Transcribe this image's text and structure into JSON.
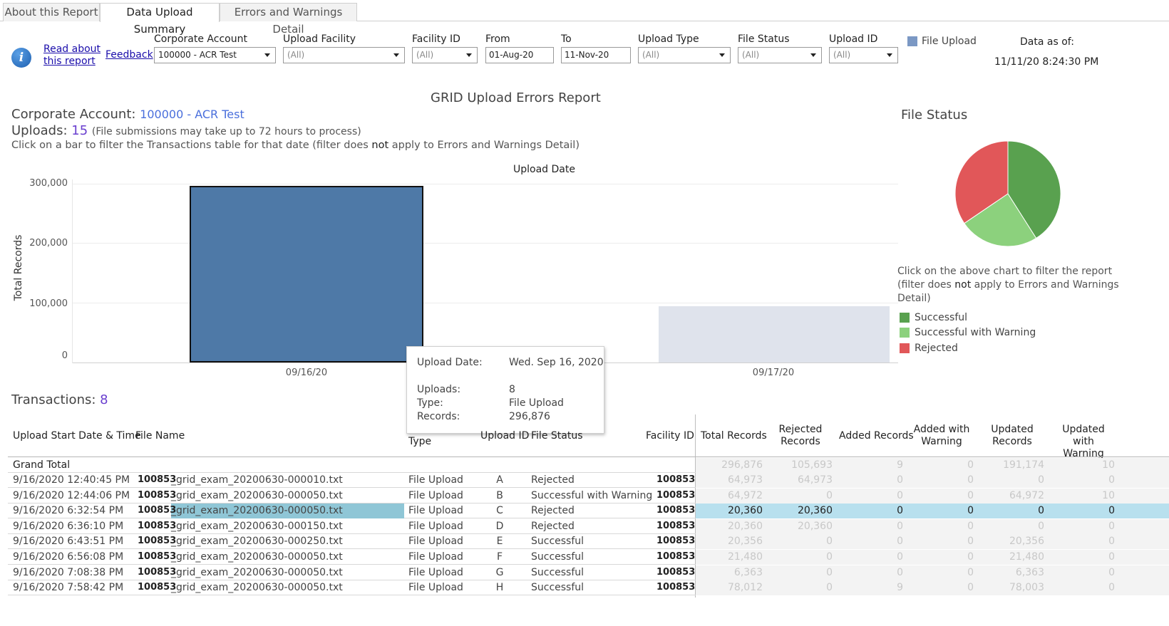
{
  "tabs": [
    "About this Report",
    "Data Upload Summary",
    "Errors and Warnings Detail"
  ],
  "header": {
    "read_about": "Read about this report",
    "read_about_line1": "Read about",
    "read_about_line2": "this report",
    "feedback": "Feedback",
    "data_as_of_label": "Data as of:",
    "data_as_of_value": "11/11/20 8:24:30 PM",
    "legend_label": "File Upload"
  },
  "filters": {
    "corporate_account": {
      "label": "Corporate Account",
      "value": "100000 - ACR Test"
    },
    "upload_facility": {
      "label": "Upload Facility",
      "value": "(All)"
    },
    "facility_id": {
      "label": "Facility ID",
      "value": "(All)"
    },
    "from": {
      "label": "From",
      "value": "01-Aug-20"
    },
    "to": {
      "label": "To",
      "value": "11-Nov-20"
    },
    "upload_type": {
      "label": "Upload Type",
      "value": "(All)"
    },
    "file_status": {
      "label": "File Status",
      "value": "(All)"
    },
    "upload_id": {
      "label": "Upload ID",
      "value": "(All)"
    }
  },
  "report": {
    "title": "GRID Upload Errors Report",
    "corp_label": "Corporate Account:",
    "corp_value": "100000 - ACR Test",
    "uploads_label": "Uploads:",
    "uploads_value": "15",
    "uploads_note": "(File submissions may take up to 72 hours to process)",
    "click_note_pre": "Click on a bar to filter the Transactions table for that date (filter does ",
    "click_note_bold": "not",
    "click_note_post": " apply to Errors and Warnings Detail)"
  },
  "chart_data": {
    "type": "bar",
    "title": "Upload Date",
    "ylabel": "Total Records",
    "categories": [
      "09/16/20",
      "09/17/20"
    ],
    "values": [
      296876,
      95000
    ],
    "yticks": [
      "300,000",
      "200,000",
      "100,000",
      "0"
    ],
    "ylim": [
      0,
      300000
    ],
    "colors": {
      "selected": "#4e79a7",
      "unselected": "#dfe3ec"
    }
  },
  "tooltip": {
    "upload_date_label": "Upload Date:",
    "upload_date_value": "Wed. Sep 16, 2020",
    "uploads_label": "Uploads:",
    "uploads_value": "8",
    "type_label": "Type:",
    "type_value": "File Upload",
    "records_label": "Records:",
    "records_value": "296,876"
  },
  "file_status": {
    "title": "File Status",
    "note_pre": "Click on the above chart to filter the report",
    "note_line2_pre": "(filter does ",
    "note_bold": "not",
    "note_line2_post": " apply to Errors and Warnings",
    "note_line3": "Detail)",
    "legend": [
      {
        "label": "Successful",
        "color": "#59a14f"
      },
      {
        "label": "Successful with Warning",
        "color": "#8cd17d"
      },
      {
        "label": "Rejected",
        "color": "#e15759"
      }
    ],
    "pie": [
      {
        "label": "Successful",
        "value": 0.41,
        "color": "#59a14f"
      },
      {
        "label": "Successful with Warning",
        "value": 0.245,
        "color": "#8cd17d"
      },
      {
        "label": "Rejected",
        "value": 0.345,
        "color": "#e15759"
      }
    ]
  },
  "transactions": {
    "label": "Transactions:",
    "count": "8",
    "headers": {
      "start": "Upload Start Date & Time",
      "file_name": "File Name",
      "type": "Type",
      "upload_id": "Upload ID",
      "file_status": "File Status",
      "facility_id": "Facility ID",
      "total_records": "Total Records",
      "rejected_records": "Rejected Records",
      "rejected_l1": "Rejected",
      "rejected_l2": "Records",
      "added_records": "Added Records",
      "added_warn_l1": "Added with",
      "added_warn_l2": "Warning",
      "updated_l1": "Updated",
      "updated_l2": "Records",
      "updated_warn_l1": "Updated with",
      "updated_warn_l2": "Warning"
    },
    "grand_total": {
      "label": "Grand Total",
      "total": "296,876",
      "rejected": "105,693",
      "added": "9",
      "added_warn": "0",
      "updated": "191,174",
      "updated_warn": "10"
    },
    "rows": [
      {
        "start": "9/16/2020 12:40:45 PM",
        "fac_prefix": "100853",
        "file": "_grid_exam_20200630-000010.txt",
        "type": "File Upload",
        "uid": "A",
        "status": "Rejected",
        "fac": "100853",
        "total": "64,973",
        "rejected": "64,973",
        "added": "0",
        "added_warn": "0",
        "updated": "0",
        "updated_warn": "0"
      },
      {
        "start": "9/16/2020 12:44:06 PM",
        "fac_prefix": "100853",
        "file": "_grid_exam_20200630-000050.txt",
        "type": "File Upload",
        "uid": "B",
        "status": "Successful with Warning",
        "fac": "100853",
        "total": "64,972",
        "rejected": "0",
        "added": "0",
        "added_warn": "0",
        "updated": "64,972",
        "updated_warn": "10"
      },
      {
        "start": "9/16/2020 6:32:54 PM",
        "fac_prefix": "100853",
        "file": "_grid_exam_20200630-000050.txt",
        "type": "File Upload",
        "uid": "C",
        "status": "Rejected",
        "fac": "100853",
        "total": "20,360",
        "rejected": "20,360",
        "added": "0",
        "added_warn": "0",
        "updated": "0",
        "updated_warn": "0"
      },
      {
        "start": "9/16/2020 6:36:10 PM",
        "fac_prefix": "100853",
        "file": "_grid_exam_20200630-000150.txt",
        "type": "File Upload",
        "uid": "D",
        "status": "Rejected",
        "fac": "100853",
        "total": "20,360",
        "rejected": "20,360",
        "added": "0",
        "added_warn": "0",
        "updated": "0",
        "updated_warn": "0"
      },
      {
        "start": "9/16/2020 6:43:51 PM",
        "fac_prefix": "100853",
        "file": "_grid_exam_20200630-000250.txt",
        "type": "File Upload",
        "uid": "E",
        "status": "Successful",
        "fac": "100853",
        "total": "20,356",
        "rejected": "0",
        "added": "0",
        "added_warn": "0",
        "updated": "20,356",
        "updated_warn": "0"
      },
      {
        "start": "9/16/2020 6:56:08 PM",
        "fac_prefix": "100853",
        "file": "_grid_exam_20200630-000050.txt",
        "type": "File Upload",
        "uid": "F",
        "status": "Successful",
        "fac": "100853",
        "total": "21,480",
        "rejected": "0",
        "added": "0",
        "added_warn": "0",
        "updated": "21,480",
        "updated_warn": "0"
      },
      {
        "start": "9/16/2020 7:08:38 PM",
        "fac_prefix": "100853",
        "file": "_grid_exam_20200630-000050.txt",
        "type": "File Upload",
        "uid": "G",
        "status": "Successful",
        "fac": "100853",
        "total": "6,363",
        "rejected": "0",
        "added": "0",
        "added_warn": "0",
        "updated": "6,363",
        "updated_warn": "0"
      },
      {
        "start": "9/16/2020 7:58:42 PM",
        "fac_prefix": "100853",
        "file": "_grid_exam_20200630-000050.txt",
        "type": "File Upload",
        "uid": "H",
        "status": "Successful",
        "fac": "100853",
        "total": "78,012",
        "rejected": "0",
        "added": "9",
        "added_warn": "0",
        "updated": "78,003",
        "updated_warn": "0"
      }
    ],
    "selected_row": 2
  }
}
